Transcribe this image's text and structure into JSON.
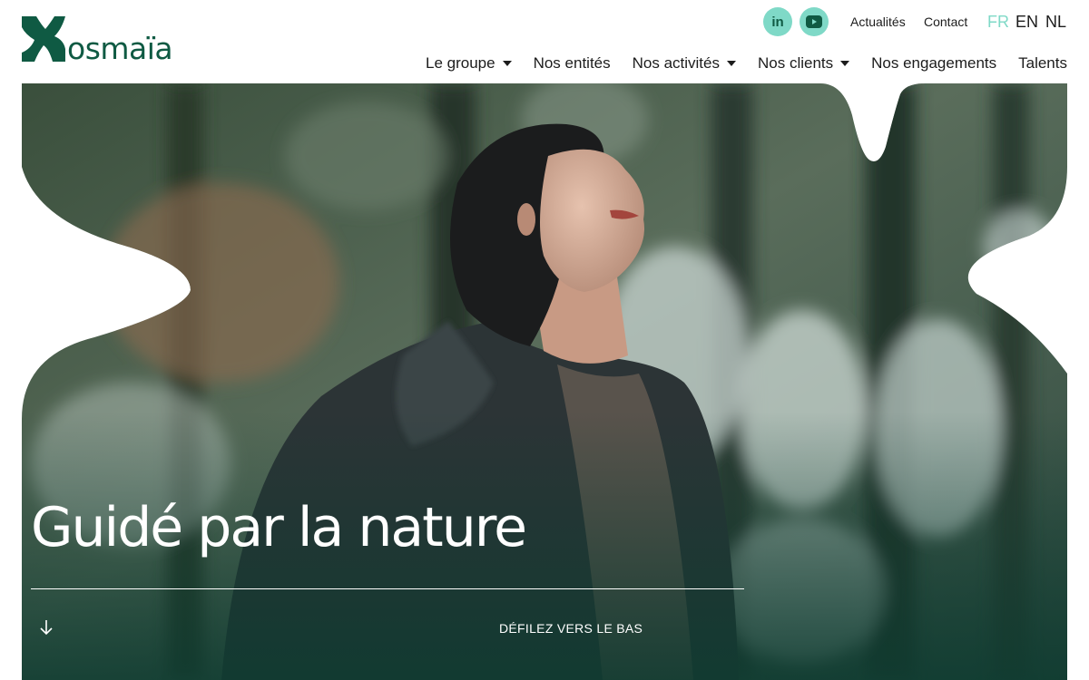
{
  "brand": {
    "name": "osmaïa",
    "color": "#0f5a43",
    "accent": "#7fd9c7"
  },
  "social": [
    {
      "label": "in",
      "icon": "linkedin-icon"
    },
    {
      "label": "▶",
      "icon": "youtube-icon"
    }
  ],
  "utility_nav": {
    "news": "Actualités",
    "contact": "Contact"
  },
  "languages": {
    "active": "FR",
    "items": [
      "FR",
      "EN",
      "NL"
    ]
  },
  "main_nav": [
    {
      "label": "Le groupe",
      "has_dropdown": true
    },
    {
      "label": "Nos entités",
      "has_dropdown": false
    },
    {
      "label": "Nos activités",
      "has_dropdown": true
    },
    {
      "label": "Nos clients",
      "has_dropdown": true
    },
    {
      "label": "Nos engagements",
      "has_dropdown": false
    },
    {
      "label": "Talents",
      "has_dropdown": false
    }
  ],
  "hero": {
    "title": "Guidé par la nature",
    "scroll_label": "DÉFILEZ VERS LE BAS",
    "scroll_icon": "arrow-down-icon",
    "image_subject": "woman-in-forest-photo"
  }
}
